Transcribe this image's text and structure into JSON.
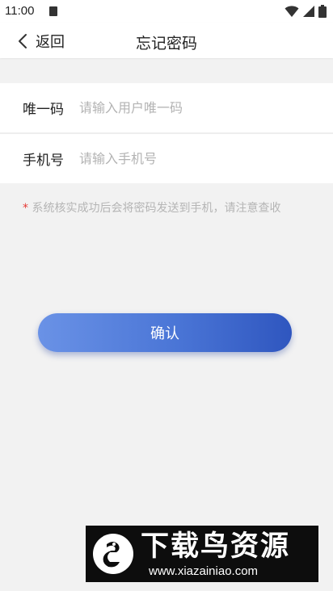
{
  "status_bar": {
    "time": "11:00",
    "icons": [
      "sim-card-icon",
      "wifi-icon",
      "signal-icon",
      "battery-icon"
    ]
  },
  "header": {
    "back_label": "返回",
    "title": "忘记密码",
    "back_icon": "chevron-left-icon"
  },
  "form": {
    "unique_code": {
      "label": "唯一码",
      "value": "",
      "placeholder": "请输入用户唯一码"
    },
    "phone": {
      "label": "手机号",
      "value": "",
      "placeholder": "请输入手机号"
    }
  },
  "hint": {
    "star": "*",
    "text": "系统核实成功后会将密码发送到手机，请注意查收"
  },
  "confirm": {
    "label": "确认"
  },
  "watermark": {
    "title": "下载鸟资源",
    "url": "www.xiazainiao.com"
  },
  "colors": {
    "accent_start": "#6a92e6",
    "accent_end": "#2f56bf",
    "hint_star": "#e53935",
    "background": "#f2f2f2"
  }
}
